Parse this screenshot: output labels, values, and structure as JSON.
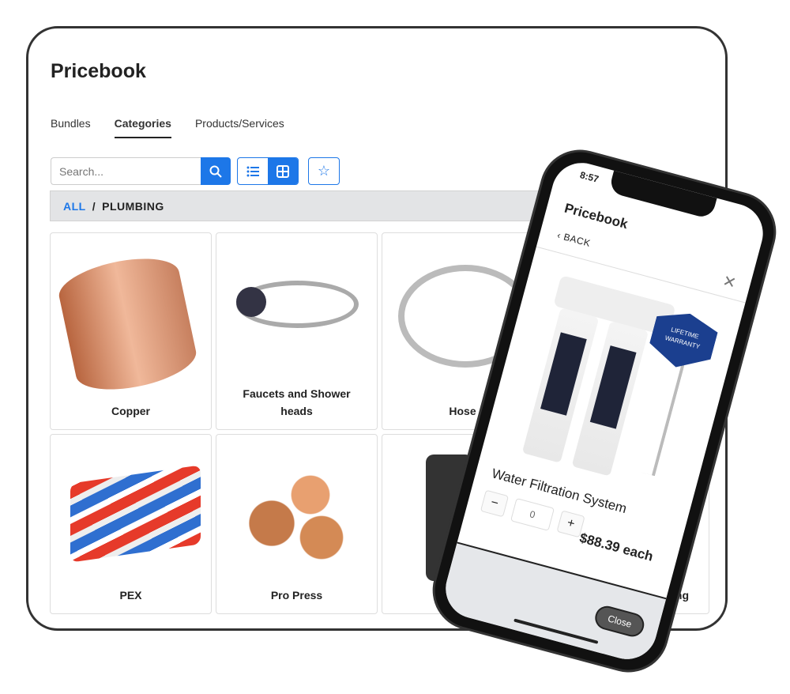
{
  "tablet": {
    "title": "Pricebook",
    "tabs": [
      {
        "label": "Bundles"
      },
      {
        "label": "Categories",
        "active": true
      },
      {
        "label": "Products/Services"
      }
    ],
    "search": {
      "placeholder": "Search..."
    },
    "breadcrumb": {
      "root": "ALL",
      "separator": "/",
      "current": "PLUMBING"
    },
    "categories": [
      {
        "label": "Copper"
      },
      {
        "label": "Faucets and Shower heads"
      },
      {
        "label": "Hose"
      },
      {
        "label": ""
      },
      {
        "label": "PEX"
      },
      {
        "label": "Pro Press"
      },
      {
        "label": ""
      },
      {
        "label": "ng"
      }
    ],
    "accent": "#1d77e8"
  },
  "phone": {
    "time": "8:57",
    "title": "Pricebook",
    "back_label": "BACK",
    "product": {
      "name": "Water Filtration System",
      "quantity": "0",
      "price": "$88.39 each",
      "badge": "LIFETIME WARRANTY"
    },
    "minus": "−",
    "plus": "+",
    "close_label": "Close"
  }
}
